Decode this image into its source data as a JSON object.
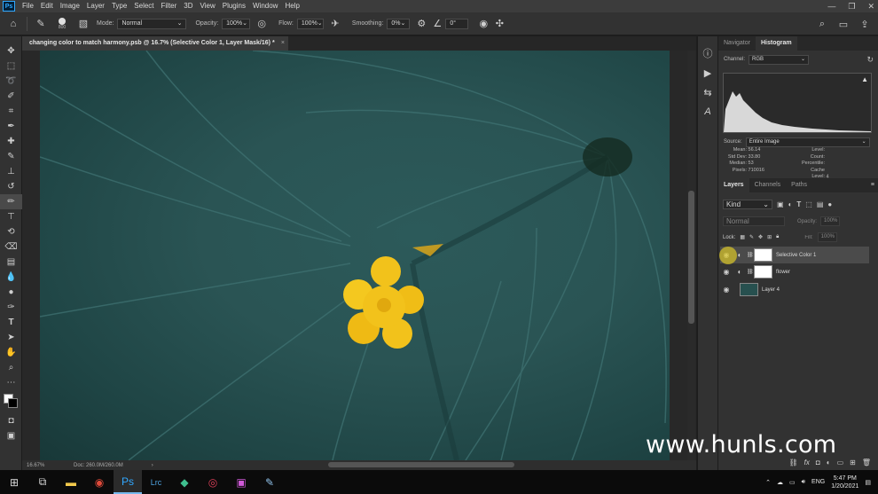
{
  "menu": [
    "File",
    "Edit",
    "Image",
    "Layer",
    "Type",
    "Select",
    "Filter",
    "3D",
    "View",
    "Plugins",
    "Window",
    "Help"
  ],
  "app_logo": "Ps",
  "window_controls": [
    "—",
    "❐",
    "✕"
  ],
  "options": {
    "brush_size": "800",
    "mode_label": "Mode:",
    "mode_value": "Normal",
    "opacity_label": "Opacity:",
    "opacity_value": "100%",
    "flow_label": "Flow:",
    "flow_value": "100%",
    "smoothing_label": "Smoothing:",
    "smoothing_value": "0%",
    "angle_value": "0°"
  },
  "document": {
    "tab_title": "changing color to match harmony.psb @ 16.7% (Selective Color 1, Layer Mask/16) *",
    "tab_close": "×",
    "zoom": "16.67%",
    "doc_size": "Doc: 260.0M/260.0M"
  },
  "histogram_panel": {
    "tabs": [
      "Navigator",
      "Histogram"
    ],
    "channel_label": "Channel:",
    "channel_value": "RGB",
    "source_label": "Source:",
    "source_value": "Entire Image",
    "stats_left": [
      {
        "k": "Mean:",
        "v": "56.14"
      },
      {
        "k": "Std Dev:",
        "v": "33.80"
      },
      {
        "k": "Median:",
        "v": "53"
      },
      {
        "k": "Pixels:",
        "v": "710016"
      }
    ],
    "stats_right": [
      {
        "k": "Level:",
        "v": ""
      },
      {
        "k": "Count:",
        "v": ""
      },
      {
        "k": "Percentile:",
        "v": ""
      },
      {
        "k": "Cache Level:",
        "v": "4"
      }
    ]
  },
  "layers_panel": {
    "tabs": [
      "Layers",
      "Channels",
      "Paths"
    ],
    "filter_value": "Kind",
    "blend_value": "Normal",
    "opacity_label": "Opacity:",
    "opacity_value": "100%",
    "lock_label": "Lock:",
    "fill_label": "Fill:",
    "fill_value": "100%",
    "layers": [
      {
        "name": "Selective Color 1",
        "selected": true
      },
      {
        "name": "flower",
        "selected": false
      },
      {
        "name": "Layer 4",
        "selected": false
      }
    ]
  },
  "watermark": "www.hunls.com",
  "taskbar": {
    "lang": "ENG",
    "time": "5:47 PM",
    "date": "1/20/2021"
  },
  "colors": {
    "accent": "#31a8ff",
    "leaf": "#2a5454",
    "flower": "#f2c21b"
  }
}
